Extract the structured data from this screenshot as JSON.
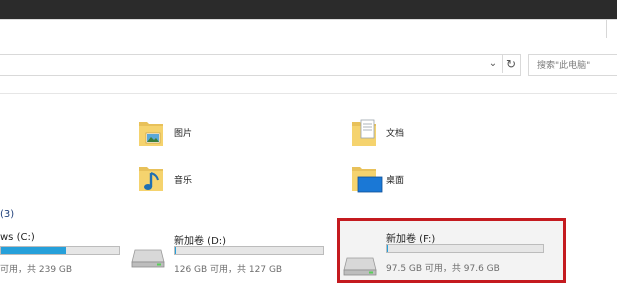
{
  "address": {
    "dropdown_icon": "chevron-down-icon",
    "refresh_icon": "refresh-icon"
  },
  "search": {
    "placeholder": "搜索\"此电脑\""
  },
  "folders": [
    {
      "label": "图片",
      "icon": "pictures-folder-icon"
    },
    {
      "label": "文档",
      "icon": "documents-folder-icon"
    },
    {
      "label": "音乐",
      "icon": "music-folder-icon"
    },
    {
      "label": "桌面",
      "icon": "desktop-folder-icon"
    }
  ],
  "devices": {
    "header": "(3)",
    "drives": [
      {
        "label": "ws (C:)",
        "capacity": "可用，共 239 GB",
        "used_fraction": 0.55,
        "icon": "windows-drive-icon"
      },
      {
        "label": "新加卷 (D:)",
        "capacity": "126 GB 可用，共 127 GB",
        "used_fraction": 0.01,
        "icon": "drive-icon"
      },
      {
        "label": "新加卷 (F:)",
        "capacity": "97.5 GB 可用，共 97.6 GB",
        "used_fraction": 0.001,
        "icon": "drive-icon"
      }
    ]
  },
  "colors": {
    "accent": "#26a0da",
    "highlight": "#c41a1f"
  }
}
